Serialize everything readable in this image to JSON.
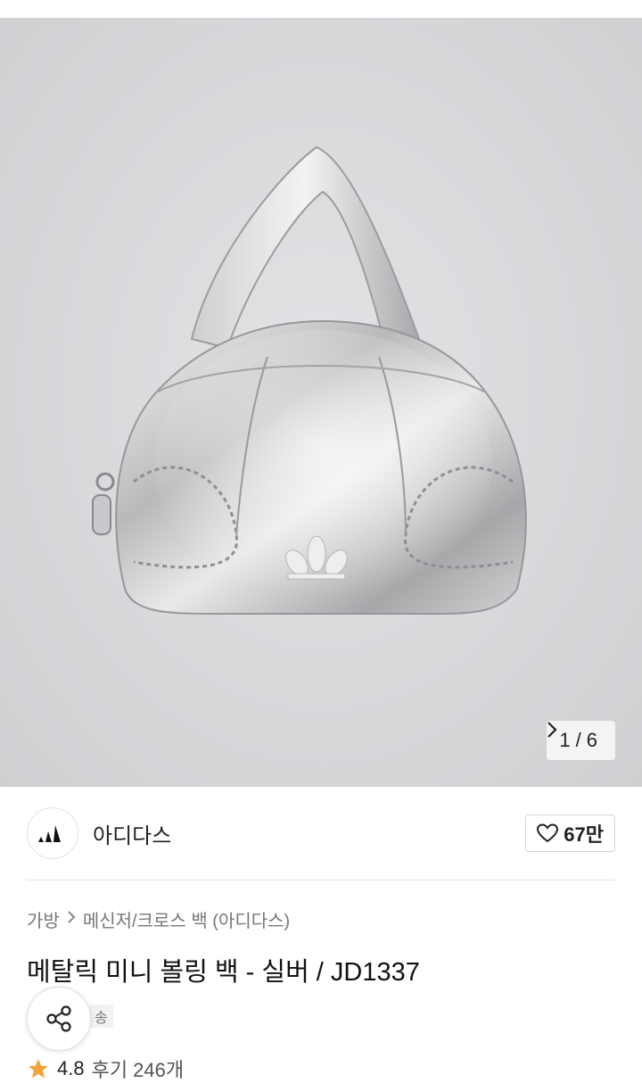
{
  "gallery": {
    "current": "1",
    "separator": "/",
    "total": "6",
    "accent_bg": "#d9d9dc"
  },
  "brand": {
    "name": "아디다스",
    "likes": "67만"
  },
  "breadcrumb": {
    "level1": "가방",
    "level2": "메신저/크로스 백 (아디다스)"
  },
  "product": {
    "title": "메탈릭 미니 볼링 백 - 실버 / JD1337"
  },
  "shipping": {
    "label": "송"
  },
  "rating": {
    "score": "4.8",
    "reviews": "후기 246개",
    "star_color": "#f4a23a"
  },
  "icons": {
    "counter_next": "chevron-right-icon",
    "like": "heart-outline-icon",
    "share": "share-icon",
    "star": "star-icon",
    "logo": "adidas-logo"
  }
}
